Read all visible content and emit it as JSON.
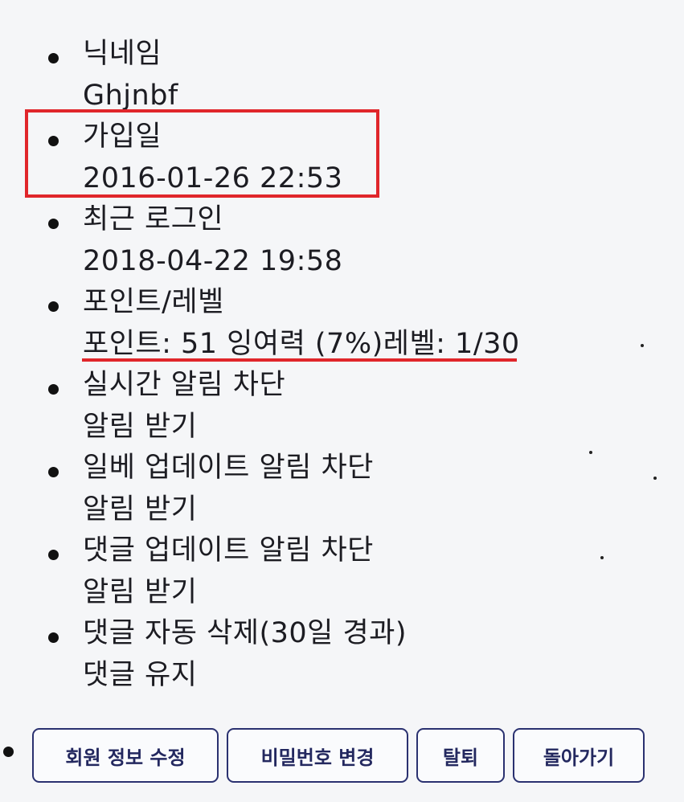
{
  "profile": {
    "items": [
      {
        "label": "닉네임",
        "value": "Ghjnbf"
      },
      {
        "label": "가입일",
        "value": "2016-01-26 22:53"
      },
      {
        "label": "최근 로그인",
        "value": "2018-04-22 19:58"
      },
      {
        "label": "포인트/레벨",
        "value": "포인트: 51 잉여력 (7%)레벨: 1/30"
      },
      {
        "label": "실시간 알림 차단",
        "value": "알림 받기"
      },
      {
        "label": "일베 업데이트 알림 차단",
        "value": "알림 받기"
      },
      {
        "label": "댓글 업데이트 알림 차단",
        "value": "알림 받기"
      },
      {
        "label": "댓글 자동 삭제(30일 경과)",
        "value": "댓글 유지"
      }
    ]
  },
  "actions": {
    "edit_profile": "회원 정보 수정",
    "change_password": "비밀번호 변경",
    "withdraw": "탈퇴",
    "go_back": "돌아가기"
  },
  "colors": {
    "highlight": "#e0262b",
    "button_border": "#2a3170",
    "background": "#f5f6f8"
  }
}
